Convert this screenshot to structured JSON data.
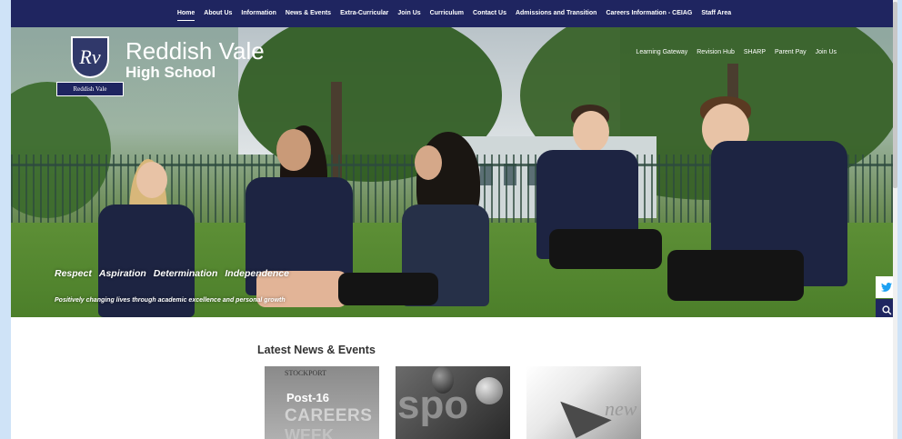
{
  "nav": {
    "items": [
      {
        "label": "Home",
        "active": true
      },
      {
        "label": "About Us"
      },
      {
        "label": "Information"
      },
      {
        "label": "News & Events"
      },
      {
        "label": "Extra-Curricular"
      },
      {
        "label": "Join Us"
      },
      {
        "label": "Curriculum"
      },
      {
        "label": "Contact Us"
      },
      {
        "label": "Admissions and Transition"
      },
      {
        "label": "Careers Information - CEIAG"
      },
      {
        "label": "Staff Area"
      }
    ]
  },
  "logo": {
    "crest_letters": "Rv",
    "ribbon_text": "Reddish Vale",
    "line1": "Reddish Vale",
    "line2": "High School"
  },
  "quicklinks": [
    "Learning Gateway",
    "Revision Hub",
    "SHARP",
    "Parent Pay",
    "Join Us"
  ],
  "hero": {
    "values": [
      "Respect",
      "Aspiration",
      "Determination",
      "Independence"
    ],
    "tagline": "Positively changing lives through academic excellence and personal growth"
  },
  "social": {
    "twitter_icon": "twitter-icon",
    "search_icon": "search-icon",
    "brand_color": "#1f2560"
  },
  "news": {
    "title": "Latest News & Events",
    "cards": [
      {
        "brand": "STOCKPORT",
        "line1": "Post-16",
        "line2": "CAREERS",
        "line3": "WEEK"
      },
      {
        "text": "spo"
      },
      {
        "text": "new"
      }
    ]
  }
}
